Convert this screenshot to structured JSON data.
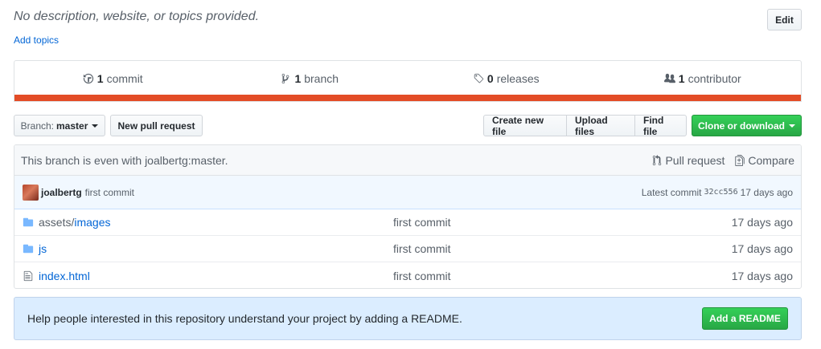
{
  "repo": {
    "description": "No description, website, or topics provided.",
    "add_topics": "Add topics",
    "edit_label": "Edit"
  },
  "summary": {
    "commits": {
      "count": "1",
      "label": "commit",
      "icon": "history-icon"
    },
    "branches": {
      "count": "1",
      "label": "branch",
      "icon": "git-branch-icon"
    },
    "releases": {
      "count": "0",
      "label": "releases",
      "icon": "tag-icon"
    },
    "contributors": {
      "count": "1",
      "label": "contributor",
      "icon": "people-icon"
    },
    "language_color": "#e34c26"
  },
  "toolbar": {
    "branch_prefix": "Branch:",
    "branch_name": "master",
    "new_pull_request": "New pull request",
    "create_new_file": "Create new file",
    "upload_files": "Upload files",
    "find_file": "Find file",
    "clone_or_download": "Clone or download"
  },
  "branch_info": {
    "text": "This branch is even with joalbertg:master.",
    "pull_request": "Pull request",
    "compare": "Compare"
  },
  "latest_commit": {
    "author": "joalbertg",
    "message": "first commit",
    "prefix": "Latest commit",
    "sha": "32cc556",
    "age": "17 days ago"
  },
  "files": [
    {
      "type": "directory",
      "dir_prefix": "assets/",
      "name": "images",
      "message": "first commit",
      "age": "17 days ago"
    },
    {
      "type": "directory",
      "dir_prefix": "",
      "name": "js",
      "message": "first commit",
      "age": "17 days ago"
    },
    {
      "type": "file",
      "dir_prefix": "",
      "name": "index.html",
      "message": "first commit",
      "age": "17 days ago"
    }
  ],
  "readme": {
    "prompt": "Help people interested in this repository understand your project by adding a README.",
    "button": "Add a README"
  },
  "colors": {
    "primary_button": "#28a745",
    "link": "#0366d6",
    "readme_bg": "#dbedff"
  }
}
